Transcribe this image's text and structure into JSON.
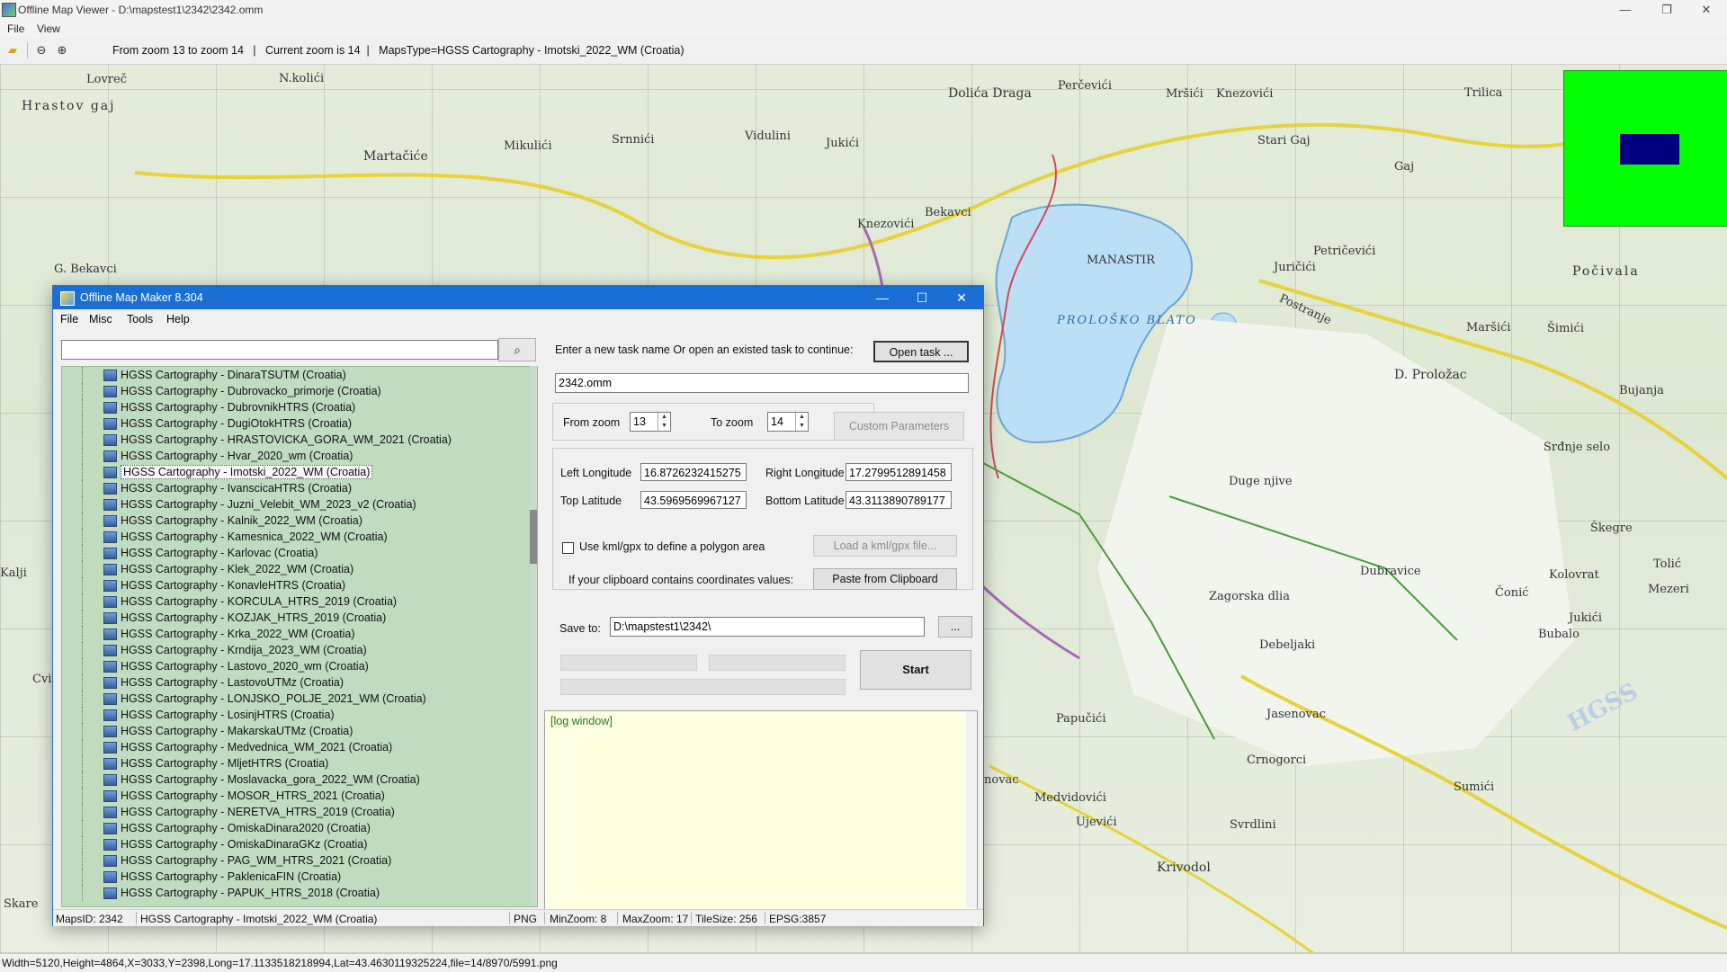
{
  "window": {
    "title": "Offline Map Viewer - D:\\mapstest1\\2342\\2342.omm",
    "controls": [
      "—",
      "❐",
      "✕"
    ]
  },
  "menu": [
    "File",
    "View"
  ],
  "toolbar": {
    "icons": [
      "open-folder-icon",
      "zoom-out-icon",
      "zoom-in-icon"
    ],
    "info": "From zoom 13 to zoom 14   |   Current zoom is 14  |   MapsType=HGSS Cartography - Imotski_2022_WM (Croatia)"
  },
  "map": {
    "labels": [
      "Lovreč",
      "N.kolići",
      "Hrastov gaj",
      "Martačiće",
      "Mikulići",
      "Srnnići",
      "Vidulini",
      "Jukići",
      "Dolića Draga",
      "Perčevići",
      "Mršići",
      "Knezovići",
      "Trilica",
      "Stari Gaj",
      "Gaj",
      "G. Bekavci",
      "Bekavci",
      "Knezovići",
      "MANASTIR",
      "PROLOŠKO BLATO",
      "Petričevići",
      "Juričići",
      "Počivala",
      "Postranje",
      "D. Proložac",
      "Maršići",
      "Šimići",
      "Bujanja",
      "Srđnje selo",
      "Duge njive",
      "Škegre",
      "Dubravice",
      "Zagorska dlia",
      "Čonić",
      "Kolovrat",
      "Mezeri",
      "Tolić",
      "Debeljaki",
      "Jukići",
      "Bubalo",
      "Papučići",
      "Jasenovac",
      "Crnogorci",
      "Sumići",
      "Medvidovići",
      "Ujevići",
      "Svrdlini",
      "Krivodol",
      "Kalji",
      "Cvit",
      "Skare",
      "novac",
      "HGSS"
    ],
    "status": "Width=5120,Height=4864,X=3033,Y=2398,Long=17.1133518218994,Lat=43.4630119325224,file=14/8970/5991.png"
  },
  "dialog": {
    "title": "Offline Map Maker 8.304",
    "menu": [
      "File",
      "Misc",
      "Tools",
      "Help"
    ],
    "search": {
      "value": "",
      "icon": "search-icon"
    },
    "maps": [
      "HGSS Cartography - DinaraTSUTM (Croatia)",
      "HGSS Cartography - Dubrovacko_primorje (Croatia)",
      "HGSS Cartography - DubrovnikHTRS (Croatia)",
      "HGSS Cartography - DugiOtokHTRS (Croatia)",
      "HGSS Cartography - HRASTOVICKA_GORA_WM_2021 (Croatia)",
      "HGSS Cartography - Hvar_2020_wm (Croatia)",
      "HGSS Cartography - Imotski_2022_WM (Croatia)",
      "HGSS Cartography - IvanscicaHTRS (Croatia)",
      "HGSS Cartography - Juzni_Velebit_WM_2023_v2 (Croatia)",
      "HGSS Cartography - Kalnik_2022_WM (Croatia)",
      "HGSS Cartography - Kamesnica_2022_WM (Croatia)",
      "HGSS Cartography - Karlovac (Croatia)",
      "HGSS Cartography - Klek_2022_WM (Croatia)",
      "HGSS Cartography - KonavleHTRS (Croatia)",
      "HGSS Cartography - KORCULA_HTRS_2019 (Croatia)",
      "HGSS Cartography - KOZJAK_HTRS_2019 (Croatia)",
      "HGSS Cartography - Krka_2022_WM (Croatia)",
      "HGSS Cartography - Krndija_2023_WM (Croatia)",
      "HGSS Cartography - Lastovo_2020_wm (Croatia)",
      "HGSS Cartography - LastovoUTMz (Croatia)",
      "HGSS Cartography - LONJSKO_POLJE_2021_WM (Croatia)",
      "HGSS Cartography - LosinjHTRS (Croatia)",
      "HGSS Cartography - MakarskaUTMz (Croatia)",
      "HGSS Cartography - Medvednica_WM_2021 (Croatia)",
      "HGSS Cartography - MljetHTRS (Croatia)",
      "HGSS Cartography - Moslavacka_gora_2022_WM (Croatia)",
      "HGSS Cartography - MOSOR_HTRS_2021 (Croatia)",
      "HGSS Cartography - NERETVA_HTRS_2019 (Croatia)",
      "HGSS Cartography - OmiskaDinara2020 (Croatia)",
      "HGSS Cartography - OmiskaDinaraGKz (Croatia)",
      "HGSS Cartography - PAG_WM_HTRS_2021 (Croatia)",
      "HGSS Cartography - PaklenicaFIN (Croatia)",
      "HGSS Cartography - PAPUK_HTRS_2018 (Croatia)"
    ],
    "selected_map": "HGSS Cartography - Imotski_2022_WM (Croatia)",
    "task_prompt": "Enter a new task name Or open an existed task to continue:",
    "open_task": "Open task ...",
    "task_name": "2342.omm",
    "from_zoom_label": "From zoom",
    "from_zoom": "13",
    "to_zoom_label": "To zoom",
    "to_zoom": "14",
    "custom_params": "Custom Parameters",
    "left_lon_label": "Left Longitude",
    "left_lon": "16.8726232415275",
    "right_lon_label": "Right Longitude",
    "right_lon": "17.2799512891458",
    "top_lat_label": "Top Latitude",
    "top_lat": "43.5969569967127",
    "bottom_lat_label": "Bottom Latitude",
    "bottom_lat": "43.3113890789177",
    "kml_label": "Use kml/gpx to define a polygon area",
    "load_kml": "Load a kml/gpx file...",
    "clipboard_label": "If your clipboard contains coordinates values:",
    "paste": "Paste from Clipboard",
    "save_label": "Save to:",
    "save_path": "D:\\mapstest1\\2342\\",
    "browse": "...",
    "start": "Start",
    "log": "[log window]",
    "status": {
      "mapsid": "MapsID: 2342",
      "maptype": "HGSS Cartography - Imotski_2022_WM (Croatia)",
      "format": "PNG",
      "minzoom": "MinZoom: 8",
      "maxzoom": "MaxZoom: 17",
      "tilesize": "TileSize: 256",
      "epsg": "EPSG:3857"
    }
  },
  "colors": {
    "list_bg": "#bfdcbf",
    "overview_bg": "#00ff00",
    "viewport": "#00007f",
    "titlebar": "#1a6fd4",
    "log_bg": "#ffffe1"
  }
}
